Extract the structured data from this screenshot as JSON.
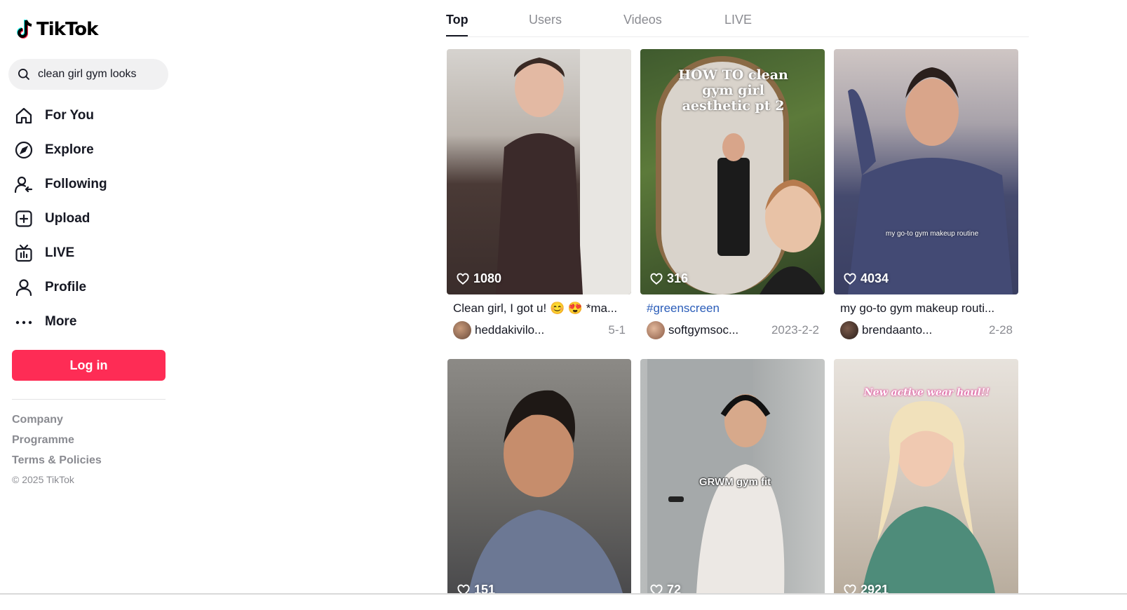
{
  "brand": {
    "name": "TikTok",
    "accent": "#fe2c55"
  },
  "search": {
    "query": "clean girl gym looks"
  },
  "nav": [
    {
      "label": "For You",
      "icon": "home-icon"
    },
    {
      "label": "Explore",
      "icon": "compass-icon"
    },
    {
      "label": "Following",
      "icon": "following-icon"
    },
    {
      "label": "Upload",
      "icon": "upload-icon"
    },
    {
      "label": "LIVE",
      "icon": "live-icon"
    },
    {
      "label": "Profile",
      "icon": "profile-icon"
    },
    {
      "label": "More",
      "icon": "more-icon"
    }
  ],
  "login_label": "Log in",
  "footer": {
    "links": [
      "Company",
      "Programme",
      "Terms & Policies"
    ],
    "copyright": "© 2025 TikTok"
  },
  "tabs": [
    {
      "label": "Top",
      "active": true
    },
    {
      "label": "Users",
      "active": false
    },
    {
      "label": "Videos",
      "active": false
    },
    {
      "label": "LIVE",
      "active": false
    }
  ],
  "videos": [
    {
      "likes": "1080",
      "caption": "Clean girl, I got u! 😊 😍 *ma...",
      "author": "heddakivilo...",
      "date": "5-1",
      "overlay": ""
    },
    {
      "likes": "316",
      "caption": "#greenscreen",
      "author": "softgymsoc...",
      "date": "2023-2-2",
      "overlay": "HOW TO clean gym girl aesthetic pt 2"
    },
    {
      "likes": "4034",
      "caption": "my go-to gym makeup routi...",
      "author": "brendaanto...",
      "date": "2-28",
      "overlay": "my go-to gym makeup routine"
    },
    {
      "likes": "151",
      "overlay": ""
    },
    {
      "likes": "72",
      "overlay": "GRWM gym fit"
    },
    {
      "likes": "2921",
      "overlay": "New active wear haul!!"
    }
  ]
}
